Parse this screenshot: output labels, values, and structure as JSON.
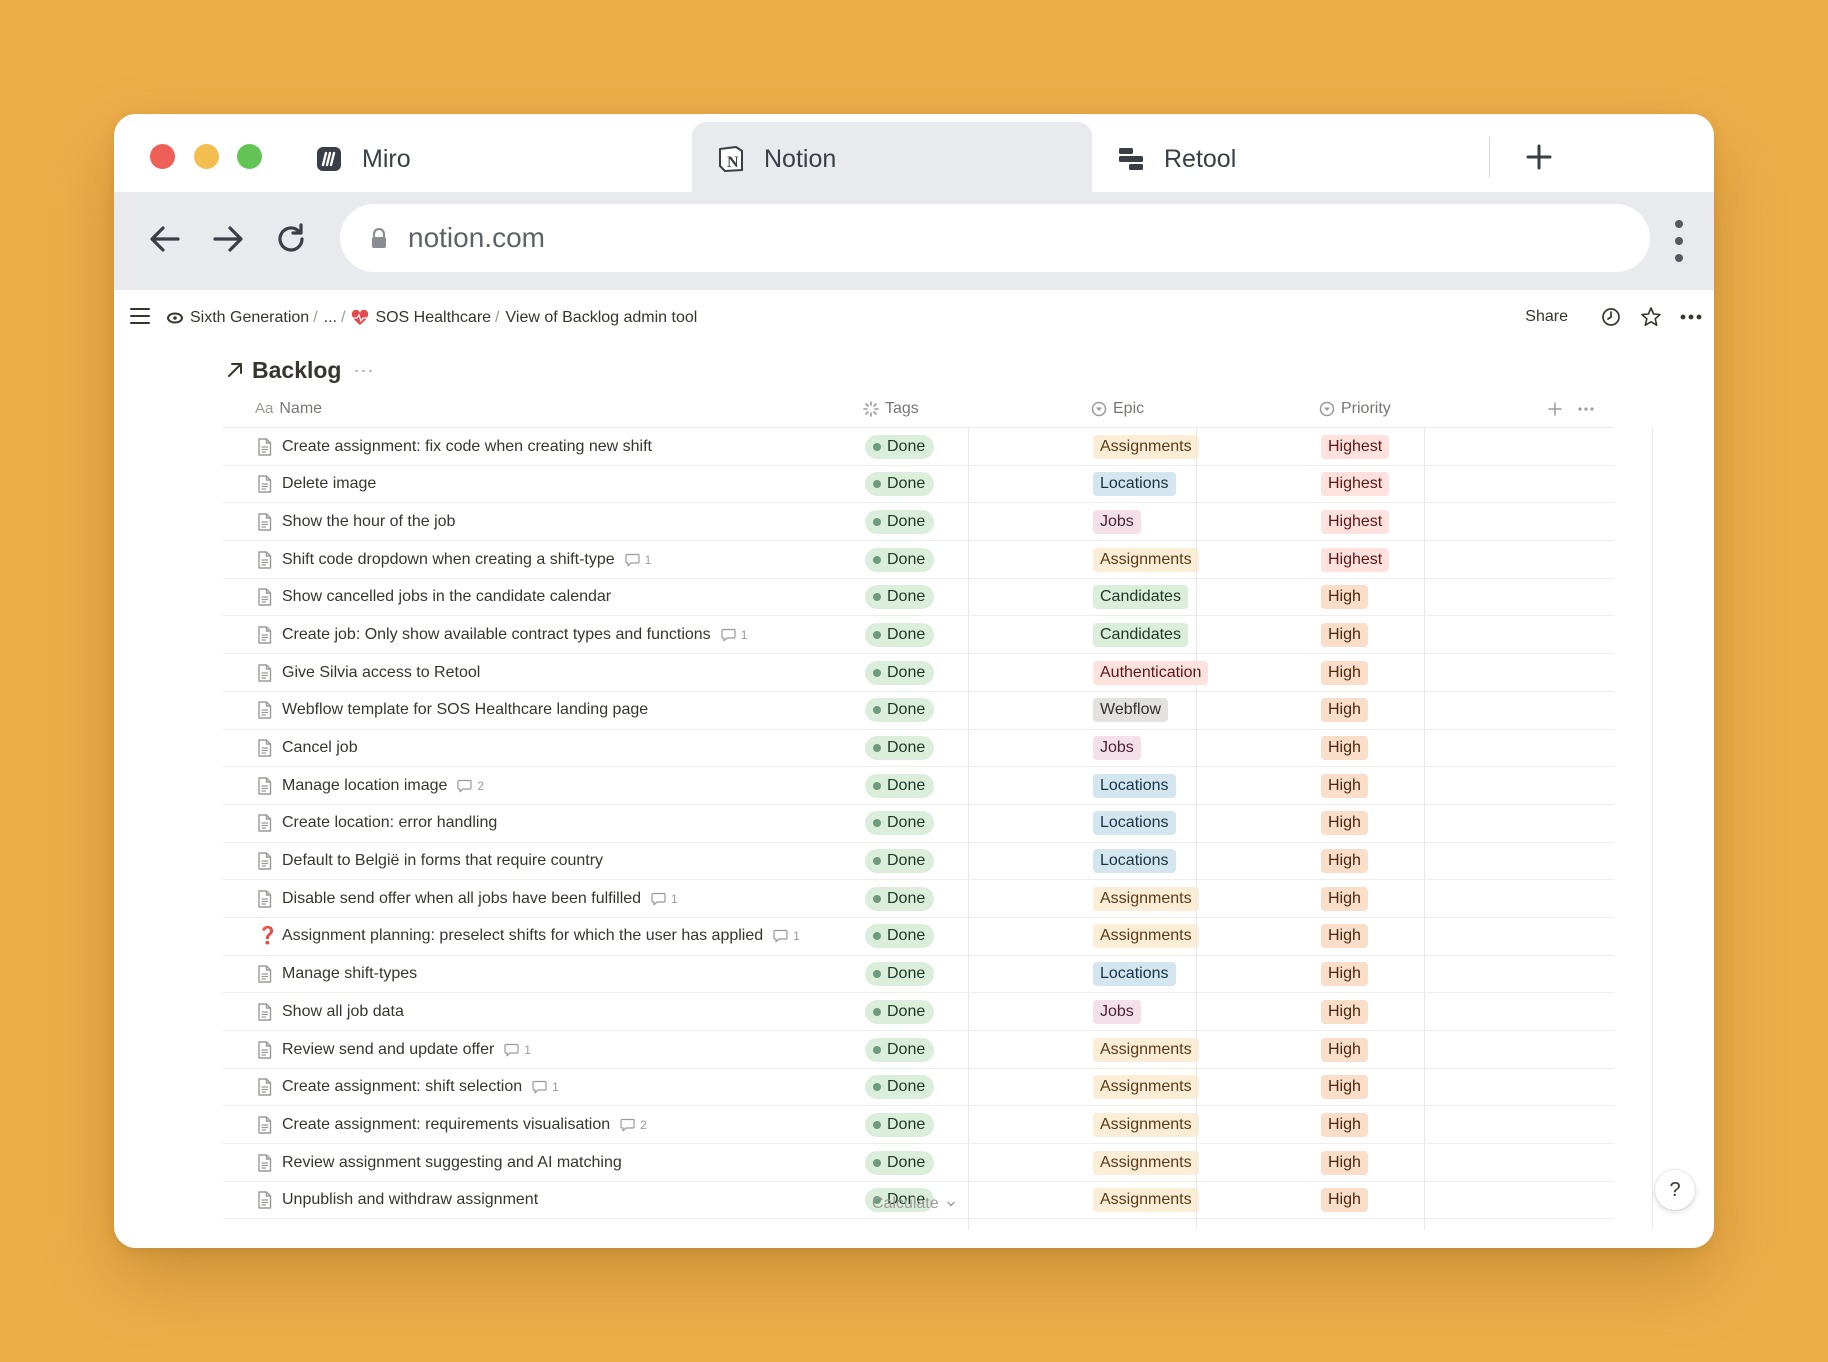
{
  "browser": {
    "tabs": [
      {
        "label": "Miro",
        "icon": "miro-icon"
      },
      {
        "label": "Notion",
        "icon": "notion-icon",
        "active": true
      },
      {
        "label": "Retool",
        "icon": "retool-icon"
      }
    ],
    "new_tab_icon": "plus-icon",
    "url": "notion.com"
  },
  "breadcrumb": {
    "items": [
      "Sixth Generation",
      "...",
      "SOS Healthcare",
      "View of Backlog admin tool"
    ],
    "share_label": "Share"
  },
  "database": {
    "title": "Backlog",
    "more": "···",
    "columns": {
      "name": "Name",
      "name_prefix": "Aa",
      "tags": "Tags",
      "epic": "Epic",
      "priority": "Priority"
    },
    "calculate_label": "Calculate"
  },
  "rows": [
    {
      "name": "Create assignment: fix code when creating new shift",
      "comments": "",
      "tag": "Done",
      "epic": "Assignments",
      "priority": "Highest"
    },
    {
      "name": "Delete image",
      "comments": "",
      "tag": "Done",
      "epic": "Locations",
      "priority": "Highest"
    },
    {
      "name": "Show the hour of the job",
      "comments": "",
      "tag": "Done",
      "epic": "Jobs",
      "priority": "Highest"
    },
    {
      "name": "Shift code dropdown when creating a shift-type",
      "comments": "1",
      "tag": "Done",
      "epic": "Assignments",
      "priority": "Highest"
    },
    {
      "name": "Show cancelled jobs in the candidate calendar",
      "comments": "",
      "tag": "Done",
      "epic": "Candidates",
      "priority": "High"
    },
    {
      "name": "Create job: Only show available contract types and functions",
      "comments": "1",
      "tag": "Done",
      "epic": "Candidates",
      "priority": "High"
    },
    {
      "name": "Give Silvia access to Retool",
      "comments": "",
      "tag": "Done",
      "epic": "Authentication",
      "priority": "High"
    },
    {
      "name": "Webflow template for SOS Healthcare landing page",
      "comments": "",
      "tag": "Done",
      "epic": "Webflow",
      "priority": "High"
    },
    {
      "name": "Cancel job",
      "comments": "",
      "tag": "Done",
      "epic": "Jobs",
      "priority": "High"
    },
    {
      "name": "Manage location image",
      "comments": "2",
      "tag": "Done",
      "epic": "Locations",
      "priority": "High"
    },
    {
      "name": "Create location: error handling",
      "comments": "",
      "tag": "Done",
      "epic": "Locations",
      "priority": "High"
    },
    {
      "name": "Default to België in forms that require country",
      "comments": "",
      "tag": "Done",
      "epic": "Locations",
      "priority": "High"
    },
    {
      "name": "Disable send offer when all jobs have been fulfilled",
      "comments": "1",
      "tag": "Done",
      "epic": "Assignments",
      "priority": "High"
    },
    {
      "name": "Assignment planning: preselect shifts for which the user has applied",
      "comments": "1",
      "tag": "Done",
      "epic": "Assignments",
      "priority": "High",
      "icon": "❓"
    },
    {
      "name": "Manage shift-types",
      "comments": "",
      "tag": "Done",
      "epic": "Locations",
      "priority": "High"
    },
    {
      "name": "Show all job data",
      "comments": "",
      "tag": "Done",
      "epic": "Jobs",
      "priority": "High"
    },
    {
      "name": "Review send and update offer",
      "comments": "1",
      "tag": "Done",
      "epic": "Assignments",
      "priority": "High"
    },
    {
      "name": "Create assignment: shift selection",
      "comments": "1",
      "tag": "Done",
      "epic": "Assignments",
      "priority": "High"
    },
    {
      "name": "Create assignment: requirements visualisation",
      "comments": "2",
      "tag": "Done",
      "epic": "Assignments",
      "priority": "High"
    },
    {
      "name": "Review assignment suggesting and AI matching",
      "comments": "",
      "tag": "Done",
      "epic": "Assignments",
      "priority": "High"
    },
    {
      "name": "Unpublish and withdraw assignment",
      "comments": "",
      "tag": "Done",
      "epic": "Assignments",
      "priority": "High"
    }
  ],
  "colors": {
    "epic": {
      "Assignments": {
        "bg": "#FBEDD6",
        "fg": "#5C3B18"
      },
      "Locations": {
        "bg": "#D3E5EF",
        "fg": "#183347"
      },
      "Jobs": {
        "bg": "#F5E0E9",
        "fg": "#4C2337"
      },
      "Candidates": {
        "bg": "#DBEDDB",
        "fg": "#1C3829"
      },
      "Authentication": {
        "bg": "#FFE2DD",
        "fg": "#5D1715"
      },
      "Webflow": {
        "bg": "#E3E2E0",
        "fg": "#32302C"
      }
    },
    "priority": {
      "Highest": {
        "bg": "#FFE2DD",
        "fg": "#5D1715"
      },
      "High": {
        "bg": "#FADEC9",
        "fg": "#49290E"
      }
    }
  }
}
